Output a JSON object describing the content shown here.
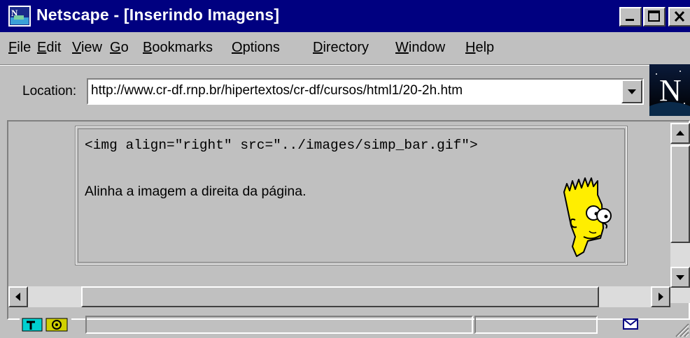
{
  "window": {
    "title": "Netscape - [Inserindo Imagens]",
    "icon": "netscape-app-icon",
    "controls": [
      "minimize-icon",
      "maximize-icon",
      "close-icon"
    ]
  },
  "menu": {
    "items": [
      {
        "mnemonic": "F",
        "rest": "ile"
      },
      {
        "mnemonic": "E",
        "rest": "dit"
      },
      {
        "mnemonic": "V",
        "rest": "iew"
      },
      {
        "mnemonic": "G",
        "rest": "o"
      },
      {
        "mnemonic": "B",
        "rest": "ookmarks"
      },
      {
        "mnemonic": "O",
        "rest": "ptions"
      },
      {
        "mnemonic": "D",
        "rest": "irectory"
      },
      {
        "mnemonic": "W",
        "rest": "indow"
      },
      {
        "mnemonic": "H",
        "rest": "elp"
      }
    ]
  },
  "location": {
    "label": "Location:",
    "url": "http://www.cr-df.rnp.br/hipertextos/cr-df/cursos/html1/20-2h.htm"
  },
  "logo": {
    "letter": "N"
  },
  "content": {
    "code": "<img align=\"right\" src=\"../images/simp_bar.gif\">",
    "description": "Alinha a imagem a direita da página.",
    "image": "bart-simpson-image"
  },
  "statusbar": {
    "security_icon": "security-key-icon",
    "mail_icon": "mail-icon"
  },
  "colors": {
    "titlebar": "#000080",
    "face": "#c0c0c0"
  }
}
